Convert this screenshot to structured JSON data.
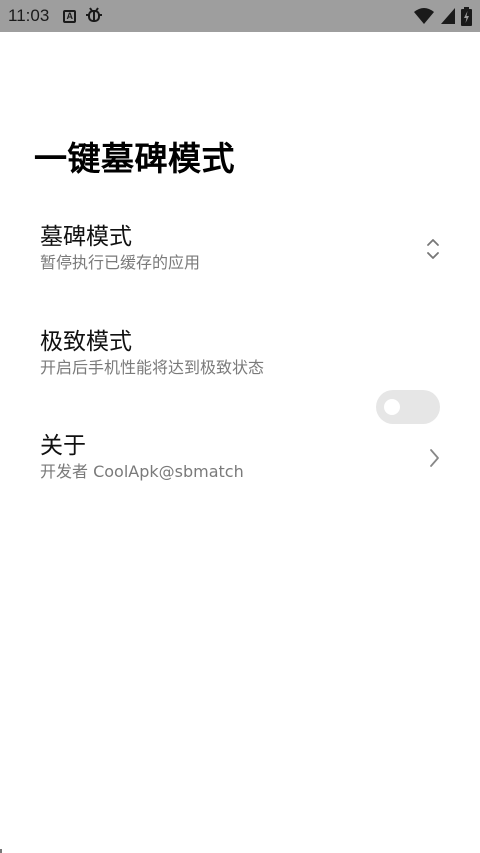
{
  "status_bar": {
    "time": "11:03",
    "left_icons": [
      "a-box-icon",
      "bug-icon"
    ],
    "a_label": "A",
    "right_icons": [
      "wifi-icon",
      "signal-icon",
      "battery-charging-icon"
    ]
  },
  "page": {
    "title": "一键墓碑模式"
  },
  "settings": [
    {
      "title": "墓碑模式",
      "subtitle": "暂停执行已缓存的应用",
      "control": "expand-collapse-icon"
    },
    {
      "title": "极致模式",
      "subtitle": "开启后手机性能将达到极致状态",
      "control": "toggle",
      "toggle_on": false
    },
    {
      "title": "关于",
      "subtitle": "开发者 CoolApk@sbmatch",
      "control": "chevron-right-icon"
    }
  ],
  "colors": {
    "status_bar_bg": "#9e9e9e",
    "background": "#ffffff",
    "subtitle_text": "#7a7a7a",
    "toggle_track": "#e6e6e6"
  }
}
